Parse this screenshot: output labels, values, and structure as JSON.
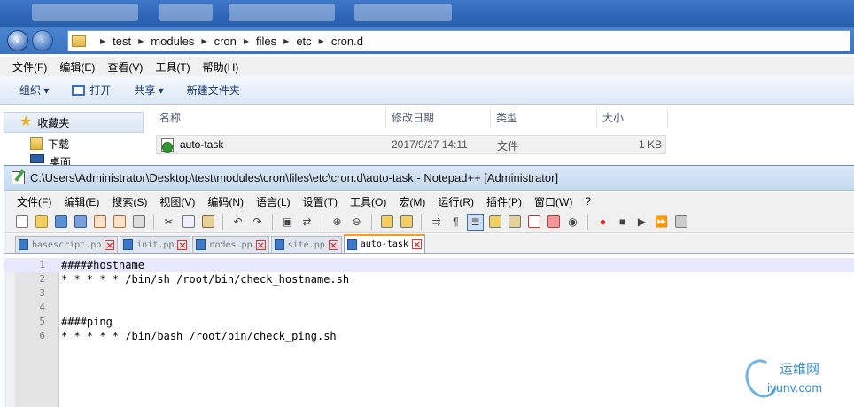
{
  "explorer": {
    "breadcrumb": [
      "test",
      "modules",
      "cron",
      "files",
      "etc",
      "cron.d"
    ],
    "menu": [
      "文件(F)",
      "编辑(E)",
      "查看(V)",
      "工具(T)",
      "帮助(H)"
    ],
    "commands": {
      "organize": "组织 ▾",
      "open": "打开",
      "share": "共享 ▾",
      "new_folder": "新建文件夹"
    },
    "nav": {
      "favorites": "收藏夹",
      "downloads": "下载",
      "desktop": "桌面"
    },
    "columns": {
      "name": "名称",
      "modified": "修改日期",
      "type": "类型",
      "size": "大小"
    },
    "file": {
      "name": "auto-task",
      "modified": "2017/9/27 14:11",
      "type": "文件",
      "size": "1 KB"
    }
  },
  "notepad": {
    "title": "C:\\Users\\Administrator\\Desktop\\test\\modules\\cron\\files\\etc\\cron.d\\auto-task - Notepad++ [Administrator]",
    "menu": [
      "文件(F)",
      "编辑(E)",
      "搜索(S)",
      "视图(V)",
      "编码(N)",
      "语言(L)",
      "设置(T)",
      "工具(O)",
      "宏(M)",
      "运行(R)",
      "插件(P)",
      "窗口(W)",
      "?"
    ],
    "tabs": [
      "basescript.pp",
      "init.pp",
      "nodes.pp",
      "site.pp",
      "auto-task"
    ],
    "active_tab": "auto-task",
    "lines": [
      {
        "n": "1",
        "text": "#####hostname"
      },
      {
        "n": "2",
        "text": "* * * * * /bin/sh /root/bin/check_hostname.sh"
      },
      {
        "n": "3",
        "text": ""
      },
      {
        "n": "4",
        "text": ""
      },
      {
        "n": "5",
        "text": "####ping"
      },
      {
        "n": "6",
        "text": "* * * * * /bin/bash /root/bin/check_ping.sh"
      }
    ]
  },
  "watermark": {
    "cn": "运维网",
    "en": "iyunv.com"
  }
}
